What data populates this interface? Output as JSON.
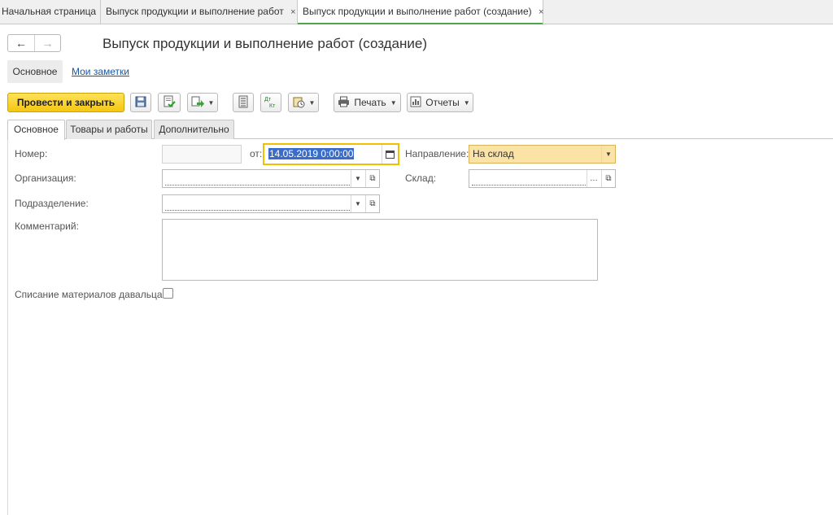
{
  "app_tabs": [
    {
      "label": "Начальная страница",
      "closable": false,
      "active": false
    },
    {
      "label": "Выпуск продукции и выполнение работ",
      "closable": true,
      "active": false
    },
    {
      "label": "Выпуск продукции и выполнение работ (создание)",
      "closable": true,
      "active": true
    }
  ],
  "close_glyph": "×",
  "nav": {
    "back": "←",
    "forward": "→"
  },
  "title": "Выпуск продукции и выполнение работ (создание)",
  "subnav": {
    "main": "Основное",
    "notes": "Мои заметки"
  },
  "toolbar": {
    "post_close": "Провести и закрыть",
    "print": "Печать",
    "reports": "Отчеты",
    "icons": [
      "save-icon",
      "post-icon",
      "create-based-icon",
      "document-list-icon",
      "journal-entries-icon",
      "attach-file-icon",
      "printer-icon",
      "reports-icon"
    ]
  },
  "form_tabs": [
    "Основное",
    "Товары и работы",
    "Дополнительно"
  ],
  "form": {
    "number_label": "Номер:",
    "number_value": "",
    "date_prefix": "от:",
    "date_value": "14.05.2019  0:00:00",
    "direction_label": "Направление:",
    "direction_value": "На склад",
    "org_label": "Организация:",
    "org_value": "",
    "warehouse_label": "Склад:",
    "warehouse_value": "",
    "dept_label": "Подразделение:",
    "dept_value": "",
    "comment_label": "Комментарий:",
    "comment_value": "",
    "writeoff_label": "Списание материалов давальца:",
    "writeoff_checked": false
  },
  "colors": {
    "accent": "#4ca44c",
    "primary_button": "#f5c712",
    "focus_border": "#f0c000",
    "direction_bg": "#fbe3a6",
    "link": "#1a56a0",
    "date_selection": "#3b6cc8"
  }
}
